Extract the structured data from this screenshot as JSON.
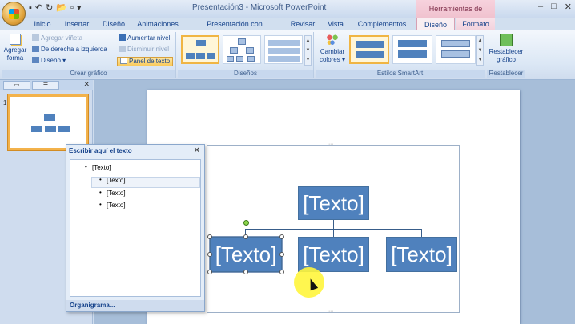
{
  "titlebar": {
    "app_title": "Presentación3 - Microsoft PowerPoint",
    "context_title": "Herramientas de SmartArt"
  },
  "tabs": [
    {
      "label": "Inicio"
    },
    {
      "label": "Insertar"
    },
    {
      "label": "Diseño"
    },
    {
      "label": "Animaciones"
    },
    {
      "label": "Presentación con diapositivas"
    },
    {
      "label": "Revisar"
    },
    {
      "label": "Vista"
    },
    {
      "label": "Complementos"
    },
    {
      "label": "Diseño"
    },
    {
      "label": "Formato"
    }
  ],
  "active_tab": "Diseño",
  "ribbon": {
    "crear_grafico": {
      "label": "Crear gráfico",
      "agregar_forma": "Agregar forma",
      "agregar_vineta": "Agregar viñeta",
      "derecha_izquierda": "De derecha a izquierda",
      "diseno": "Diseño",
      "aumentar_nivel": "Aumentar nivel",
      "disminuir_nivel": "Disminuir nivel",
      "panel_texto": "Panel de texto"
    },
    "disenos": {
      "label": "Diseños"
    },
    "estilos": {
      "label": "Estilos SmartArt",
      "cambiar_colores": "Cambiar colores"
    },
    "restablecer": {
      "label": "Restablecer",
      "restablecer_grafico": "Restablecer gráfico"
    }
  },
  "slides_pane": {
    "slide_number": "1"
  },
  "text_pane": {
    "title": "Escribir aquí el texto",
    "items": [
      "[Texto]",
      "[Texto]",
      "[Texto]",
      "[Texto]"
    ],
    "footer": "Organigrama..."
  },
  "smartart": {
    "top_box": "[Texto]",
    "children": [
      "[Texto]",
      "[Texto]",
      "[Texto]"
    ]
  },
  "colors": {
    "box_fill": "#4f81bd",
    "selection_highlight": "#f3b24b"
  }
}
